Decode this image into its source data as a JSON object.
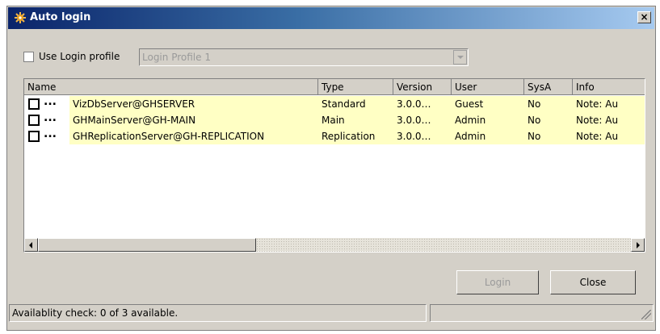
{
  "window": {
    "title": "Auto login",
    "close_label": "×"
  },
  "profile": {
    "use_label": "Use Login profile",
    "checked": false,
    "combo_value": "Login Profile 1"
  },
  "table": {
    "headers": [
      "Name",
      "Type",
      "Version",
      "User",
      "SysA",
      "Info"
    ],
    "rows": [
      {
        "name": "VizDbServer@GHSERVER",
        "type": "Standard",
        "version": "3.0.0…",
        "user": "Guest",
        "sysa": "No",
        "info": "Note: Au"
      },
      {
        "name": "GHMainServer@GH-MAIN",
        "type": "Main",
        "version": "3.0.0…",
        "user": "Admin",
        "sysa": "No",
        "info": "Note: Au"
      },
      {
        "name": "GHReplicationServer@GH-REPLICATION",
        "type": "Replication",
        "version": "3.0.0…",
        "user": "Admin",
        "sysa": "No",
        "info": "Note: Au"
      }
    ],
    "row_dots": "..."
  },
  "buttons": {
    "login": "Login",
    "close": "Close"
  },
  "status": {
    "text": "Availablity check: 0 of 3 available."
  },
  "colors": {
    "row_highlight": "#ffffc4",
    "title_start": "#0a246a",
    "title_end": "#a6caf0",
    "icon_accent": "#e8a020"
  },
  "icons": {
    "app": "gear-icon",
    "row_marker": "more-dots-icon"
  }
}
